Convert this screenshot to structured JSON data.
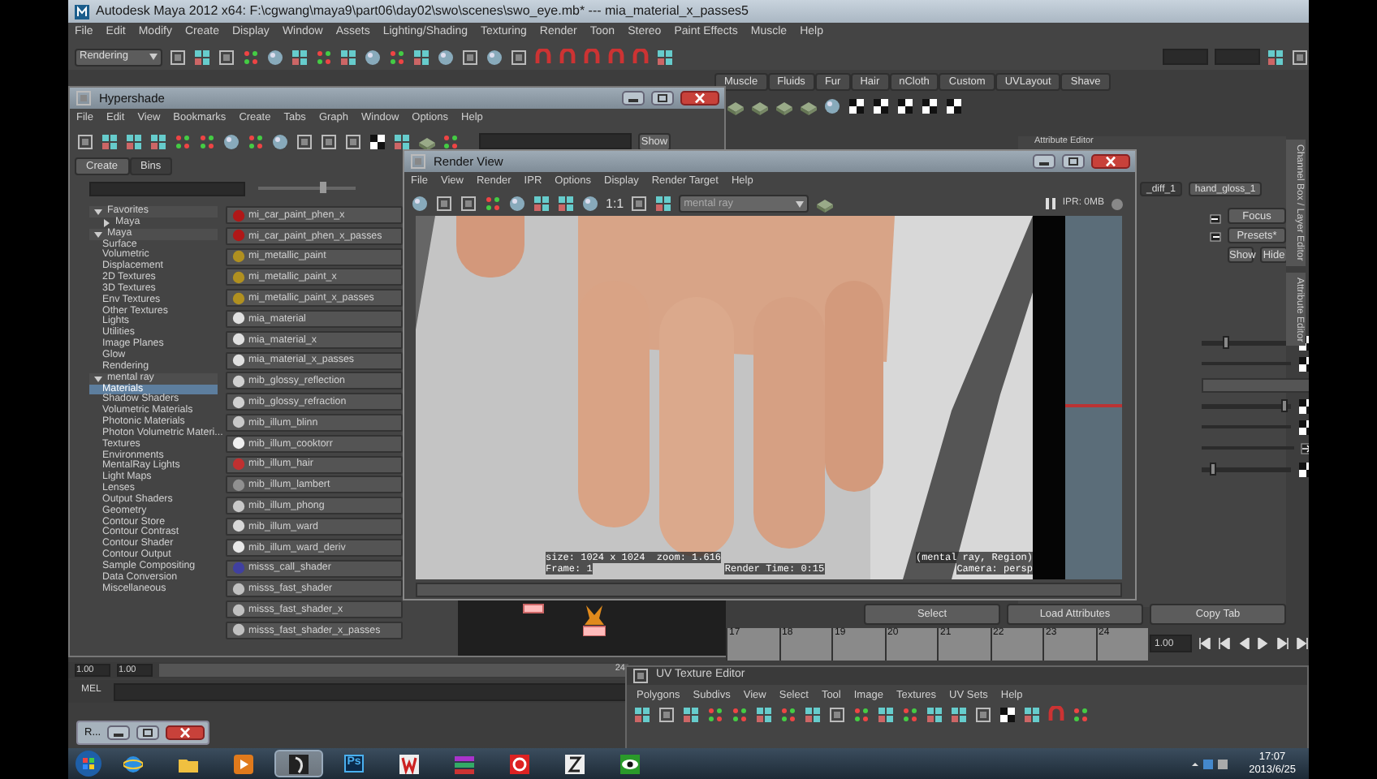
{
  "main_window": {
    "title": "Autodesk Maya 2012 x64: F:\\cgwang\\maya9\\part06\\day02\\swo\\scenes\\swo_eye.mb*  ---  mia_material_x_passes5",
    "menu": [
      "File",
      "Edit",
      "Modify",
      "Create",
      "Display",
      "Window",
      "Assets",
      "Lighting/Shading",
      "Texturing",
      "Render",
      "Toon",
      "Stereo",
      "Paint Effects",
      "Muscle",
      "Help"
    ],
    "menu_set": "Rendering",
    "shelf_tabs": [
      "Muscle",
      "Fluids",
      "Fur",
      "Hair",
      "nCloth",
      "Custom",
      "UVLayout",
      "Shave"
    ]
  },
  "hypershade": {
    "title": "Hypershade",
    "menu": [
      "File",
      "Edit",
      "View",
      "Bookmarks",
      "Create",
      "Tabs",
      "Graph",
      "Window",
      "Options",
      "Help"
    ],
    "show_button": "Show",
    "tabs": [
      {
        "label": "Create",
        "selected": true
      },
      {
        "label": "Bins",
        "selected": false
      }
    ],
    "tree": [
      {
        "label": "Favorites",
        "expanded": true,
        "selected": false,
        "children": [
          {
            "label": "Maya",
            "expanded": false,
            "selected": false
          }
        ]
      },
      {
        "label": "Maya",
        "expanded": true,
        "selected": false,
        "children": [
          {
            "label": "Surface",
            "selected": false
          },
          {
            "label": "Volumetric",
            "selected": false
          },
          {
            "label": "Displacement",
            "selected": false
          },
          {
            "label": "2D Textures",
            "selected": false
          },
          {
            "label": "3D Textures",
            "selected": false
          },
          {
            "label": "Env Textures",
            "selected": false
          },
          {
            "label": "Other Textures",
            "selected": false
          },
          {
            "label": "Lights",
            "selected": false
          },
          {
            "label": "Utilities",
            "selected": false
          },
          {
            "label": "Image Planes",
            "selected": false
          },
          {
            "label": "Glow",
            "selected": false
          },
          {
            "label": "Rendering",
            "selected": false
          }
        ]
      },
      {
        "label": "mental ray",
        "expanded": true,
        "selected": false,
        "children": [
          {
            "label": "Materials",
            "selected": true
          },
          {
            "label": "Shadow Shaders",
            "selected": false
          },
          {
            "label": "Volumetric Materials",
            "selected": false
          },
          {
            "label": "Photonic Materials",
            "selected": false
          },
          {
            "label": "Photon Volumetric Materi...",
            "selected": false
          },
          {
            "label": "Textures",
            "selected": false
          },
          {
            "label": "Environments",
            "selected": false
          },
          {
            "label": "MentalRay Lights",
            "selected": false
          },
          {
            "label": "Light Maps",
            "selected": false
          },
          {
            "label": "Lenses",
            "selected": false
          },
          {
            "label": "Output Shaders",
            "selected": false
          },
          {
            "label": "Geometry",
            "selected": false
          },
          {
            "label": "Contour Store",
            "selected": false
          },
          {
            "label": "Contour Contrast",
            "selected": false
          },
          {
            "label": "Contour Shader",
            "selected": false
          },
          {
            "label": "Contour Output",
            "selected": false
          },
          {
            "label": "Sample Compositing",
            "selected": false
          },
          {
            "label": "Data Conversion",
            "selected": false
          },
          {
            "label": "Miscellaneous",
            "selected": false
          }
        ]
      }
    ],
    "nodes": [
      {
        "name": "mi_car_paint_phen_x",
        "color": "#b01818"
      },
      {
        "name": "mi_car_paint_phen_x_passes",
        "color": "#b01818"
      },
      {
        "name": "mi_metallic_paint",
        "color": "#b09020"
      },
      {
        "name": "mi_metallic_paint_x",
        "color": "#b09020"
      },
      {
        "name": "mi_metallic_paint_x_passes",
        "color": "#b09020"
      },
      {
        "name": "mia_material",
        "color": "#e0e0e0"
      },
      {
        "name": "mia_material_x",
        "color": "#e0e0e0"
      },
      {
        "name": "mia_material_x_passes",
        "color": "#e0e0e0"
      },
      {
        "name": "mib_glossy_reflection",
        "color": "#d0d0d0"
      },
      {
        "name": "mib_glossy_refraction",
        "color": "#d0d0d0"
      },
      {
        "name": "mib_illum_blinn",
        "color": "#c8c8c8"
      },
      {
        "name": "mib_illum_cooktorr",
        "color": "#f0f0f0"
      },
      {
        "name": "mib_illum_hair",
        "color": "#c03030"
      },
      {
        "name": "mib_illum_lambert",
        "color": "#909090"
      },
      {
        "name": "mib_illum_phong",
        "color": "#c8c8c8"
      },
      {
        "name": "mib_illum_ward",
        "color": "#d8d8d8"
      },
      {
        "name": "mib_illum_ward_deriv",
        "color": "#e8e8e8"
      },
      {
        "name": "misss_call_shader",
        "color": "#4040a0"
      },
      {
        "name": "misss_fast_shader",
        "color": "#c0c0c0"
      },
      {
        "name": "misss_fast_shader_x",
        "color": "#c0c0c0"
      },
      {
        "name": "misss_fast_shader_x_passes",
        "color": "#c0c0c0"
      }
    ]
  },
  "render_view": {
    "title": "Render View",
    "menu": [
      "File",
      "View",
      "Render",
      "IPR",
      "Options",
      "Display",
      "Render Target",
      "Help"
    ],
    "zoom_button": "1:1",
    "renderer": "mental ray",
    "ipr_label": "IPR: 0MB",
    "info": [
      [
        "size: 1024 x 1024  zoom: 1.616",
        "(mental ray, Region)"
      ],
      [
        "Frame: 1",
        "Render Time: 0:15",
        "Camera: persp"
      ]
    ]
  },
  "attribute_editor": {
    "title": "Attribute Editor",
    "tabs": [
      {
        "label": "_diff_1",
        "selected": false
      },
      {
        "label": "hand_gloss_1",
        "selected": true
      }
    ],
    "buttons": [
      "Focus",
      "Presets*",
      "Show",
      "Hide"
    ],
    "rows": [
      {
        "kind": "slider",
        "level": 0.27
      },
      {
        "kind": "field"
      },
      {
        "kind": "header"
      },
      {
        "kind": "slider",
        "level": 0.92
      },
      {
        "kind": "field"
      },
      {
        "kind": "link"
      },
      {
        "kind": "slider",
        "level": 0.12
      }
    ],
    "side_tabs": [
      "Channel Box / Layer Editor",
      "Attribute Editor"
    ],
    "actions": [
      "Select",
      "Load Attributes",
      "Copy Tab"
    ]
  },
  "time_slider": {
    "frames": [
      "17",
      "18",
      "19",
      "20",
      "21",
      "22",
      "23",
      "24"
    ],
    "current_time": "1.00"
  },
  "range_slider": {
    "start": "1.00",
    "range_start": "1.00",
    "range_end": "24"
  },
  "command_line": {
    "label": "MEL"
  },
  "uv_editor": {
    "title": "UV Texture Editor",
    "menu": [
      "Polygons",
      "Subdivs",
      "View",
      "Select",
      "Tool",
      "Image",
      "Textures",
      "UV Sets",
      "Help"
    ]
  },
  "minimized_window": {
    "title": "R..."
  },
  "taskbar": {
    "apps": [
      {
        "kind": "globe",
        "selected": false
      },
      {
        "kind": "folder",
        "selected": false
      },
      {
        "kind": "play",
        "selected": false
      },
      {
        "kind": "figure",
        "selected": true
      },
      {
        "kind": "label",
        "label": "Ps",
        "selected": false
      },
      {
        "kind": "mark",
        "selected": false
      },
      {
        "kind": "stack",
        "selected": false
      },
      {
        "kind": "swirl",
        "selected": false
      },
      {
        "kind": "runner",
        "selected": false
      },
      {
        "kind": "eye",
        "selected": false
      }
    ],
    "time": "17:07",
    "date": "2013/6/25"
  }
}
